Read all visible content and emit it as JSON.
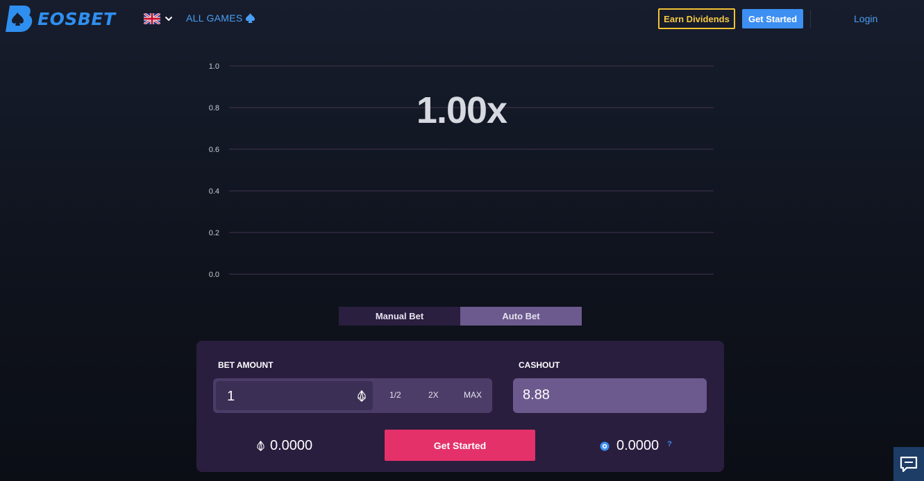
{
  "header": {
    "logo_text": "EOSBET",
    "all_games_label": "ALL GAMES",
    "earn_dividends_label": "Earn Dividends",
    "get_started_label": "Get Started",
    "login_label": "Login"
  },
  "colors": {
    "brand_blue": "#3d8ff1",
    "accent_gold": "#f2c233",
    "cta_pink": "#e4316a",
    "panel_purple": "#2a1e3f",
    "tab_active": "#6c5a8e"
  },
  "chart_data": {
    "type": "line",
    "title": "",
    "xlabel": "",
    "ylabel": "",
    "ylim": [
      0,
      1
    ],
    "y_ticks": [
      "1.0",
      "0.8",
      "0.6",
      "0.4",
      "0.2",
      "0.0"
    ],
    "grid": true,
    "series": [],
    "annotation": "1.00x"
  },
  "tabs": {
    "manual_label": "Manual Bet",
    "auto_label": "Auto Bet"
  },
  "bet_panel": {
    "bet_amount_label": "BET AMOUNT",
    "bet_amount_value": "1",
    "half_label": "1/2",
    "double_label": "2X",
    "max_label": "MAX",
    "cashout_label": "CASHOUT",
    "cashout_value": "8.88",
    "eos_balance": "0.0000",
    "token_balance": "0.0000",
    "get_started_label": "Get Started",
    "help_label": "?"
  },
  "icons": {
    "logo": "spade-b-logo-icon",
    "language": "uk-flag-icon",
    "language_toggle": "chevron-down-icon",
    "games": "spade-icon",
    "currency": "eos-icon",
    "token": "bet-token-icon",
    "chat": "chat-icon"
  }
}
